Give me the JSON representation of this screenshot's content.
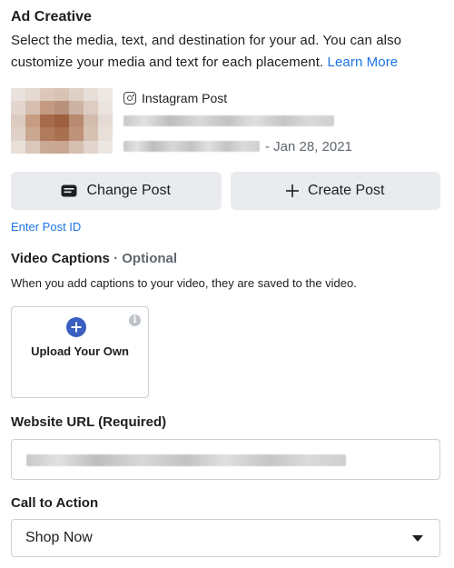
{
  "ad_creative": {
    "title": "Ad Creative",
    "description_line1": "Select the media, text, and destination for your ad. You can also",
    "description_line2": "customize your media and text for each placement.",
    "learn_more": "Learn More"
  },
  "selected_post": {
    "type_label": "Instagram Post",
    "type_icon": "instagram-icon",
    "date": "- Jan 28, 2021"
  },
  "buttons": {
    "change_post": "Change Post",
    "change_post_icon": "post-icon",
    "create_post": "Create Post",
    "create_post_icon": "plus-icon"
  },
  "enter_post_id": "Enter Post ID",
  "video_captions": {
    "title": "Video Captions",
    "optional": " · Optional",
    "description": "When you add captions to your video, they are saved to the video.",
    "upload_label": "Upload Your Own",
    "upload_icon": "plus-circle-icon",
    "info_icon": "info-icon"
  },
  "website_url": {
    "label": "Website URL (Required)"
  },
  "call_to_action": {
    "label": "Call to Action",
    "selected": "Shop Now",
    "icon": "chevron-down-icon"
  },
  "colors": {
    "link": "#1b74e4",
    "button_bg": "#e9ebee",
    "upload_icon_bg": "#3b5fc0",
    "border": "#ccd0d5"
  }
}
